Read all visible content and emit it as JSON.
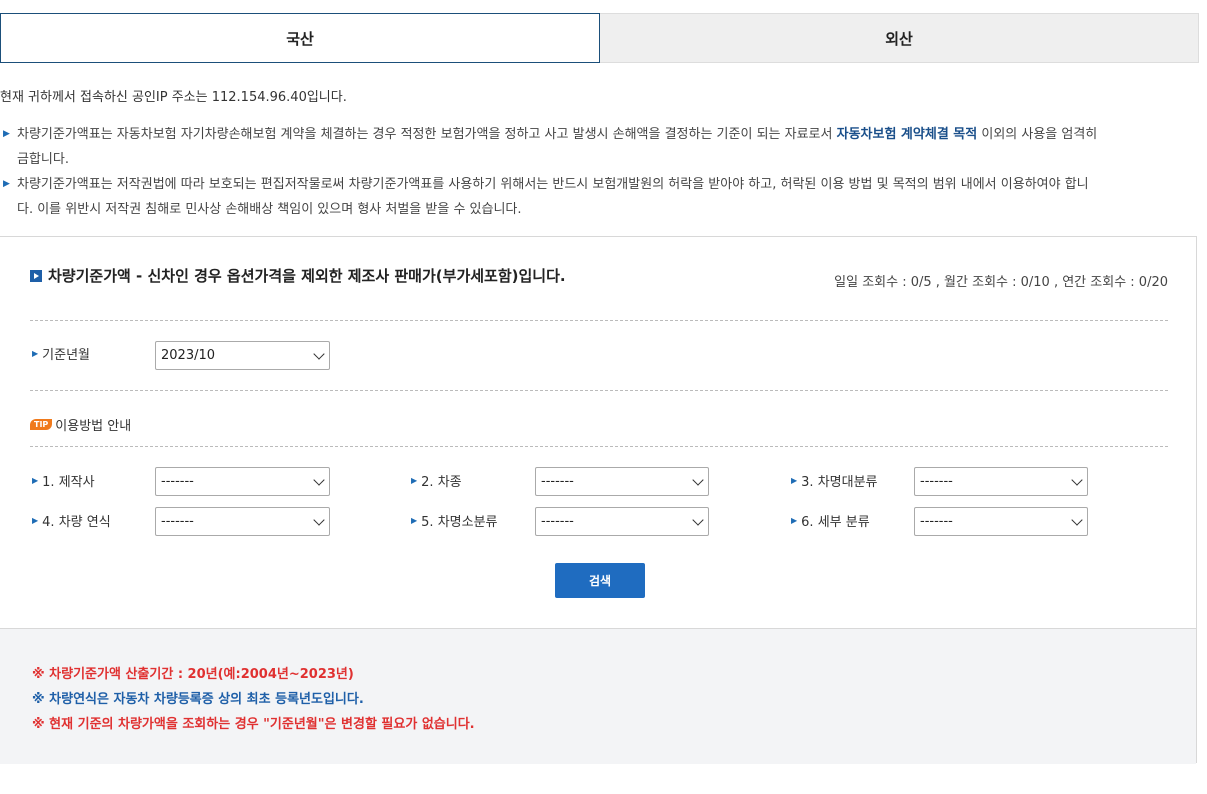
{
  "tabs": [
    {
      "label": "국산",
      "active": true
    },
    {
      "label": "외산",
      "active": false
    }
  ],
  "ip_notice": "현재 귀하께서 접속하신 공인IP 주소는 112.154.96.40입니다.",
  "notices": [
    {
      "text_before": "차량기준가액표는 자동차보험 자기차량손해보험 계약을 체결하는 경우 적정한 보험가액을 정하고 사고 발생시 손해액을 결정하는 기준이 되는 자료로서 ",
      "strong": "자동차보험 계약체결 목적",
      "text_after": " 이외의 사용을 엄격히",
      "line2": "금합니다."
    },
    {
      "line1": "차량기준가액표는 저작권법에 따라 보호되는 편집저작물로써 차량기준가액표를 사용하기 위해서는 반드시 보험개발원의 허락을 받아야 하고, 허락된 이용 방법 및 목적의 범위 내에서 이용하여야 합니",
      "line2": "다. 이를 위반시 저작권 침해로 민사상 손해배상 책임이 있으며 형사 처벌을 받을 수 있습니다."
    }
  ],
  "panel": {
    "title": "차량기준가액 - 신차인 경우 옵션가격을 제외한 제조사 판매가(부가세포함)입니다.",
    "count_text": "일일 조회수 : 0/5 , 월간 조회수 : 0/10 , 연간 조회수 : 0/20",
    "base_month_label": "기준년월",
    "base_month_value": "2023/10",
    "tip_badge": "TIP",
    "tip_label": "이용방법 안내",
    "fields": [
      {
        "label": "1. 제작사",
        "value": "-------"
      },
      {
        "label": "2. 차종",
        "value": "-------"
      },
      {
        "label": "3. 차명대분류",
        "value": "-------"
      },
      {
        "label": "4. 차량 연식",
        "value": "-------"
      },
      {
        "label": "5. 차명소분류",
        "value": "-------"
      },
      {
        "label": "6. 세부 분류",
        "value": "-------"
      }
    ],
    "search_label": "검색"
  },
  "bottom_notes": [
    {
      "text": "※ 차량기준가액 산출기간 : 20년(예:2004년~2023년)",
      "color": "#e03131"
    },
    {
      "text": "※ 차량연식은 자동차 차량등록증 상의 최초 등록년도입니다.",
      "color": "#1e5fa8"
    },
    {
      "text": "※ 현재 기준의 차량가액을 조회하는 경우 \"기준년월\"은 변경할 필요가 없습니다.",
      "color": "#e03131"
    }
  ]
}
